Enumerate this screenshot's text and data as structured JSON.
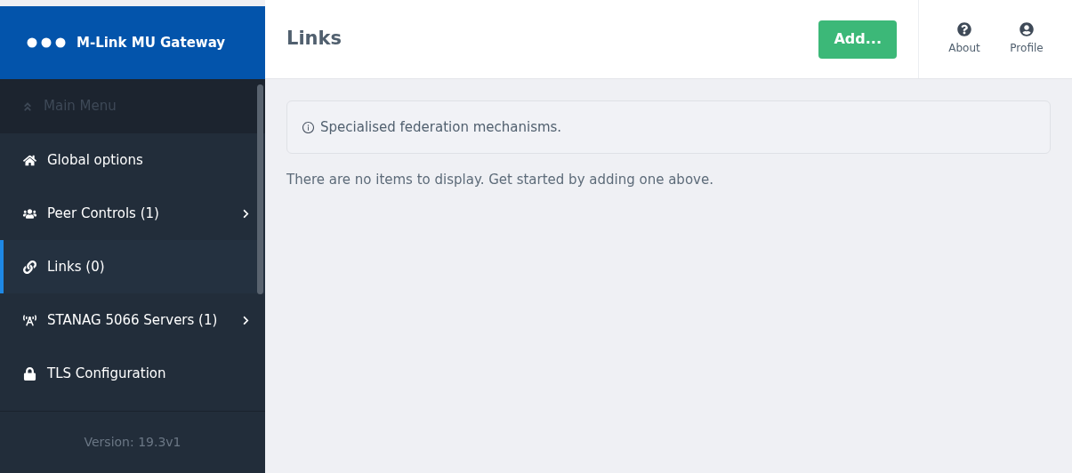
{
  "sidebar": {
    "brand": "M-Link MU Gateway",
    "back": {
      "label": "Main Menu",
      "disabled": true
    },
    "items": [
      {
        "label": "Global options",
        "selected": false,
        "has_submenu": false
      },
      {
        "label": "Peer Controls (1)",
        "selected": false,
        "has_submenu": true
      },
      {
        "label": "Links (0)",
        "selected": true,
        "has_submenu": false
      },
      {
        "label": "STANAG 5066 Servers (1)",
        "selected": false,
        "has_submenu": true
      },
      {
        "label": "TLS Configuration",
        "selected": false,
        "has_submenu": false
      }
    ],
    "version": "Version: 19.3v1"
  },
  "header": {
    "title": "Links",
    "add_button": "Add...",
    "actions": [
      {
        "label": "About"
      },
      {
        "label": "Profile"
      }
    ]
  },
  "info": "Specialised federation mechanisms.",
  "empty_message": "There are no items to display. Get started by adding one above."
}
